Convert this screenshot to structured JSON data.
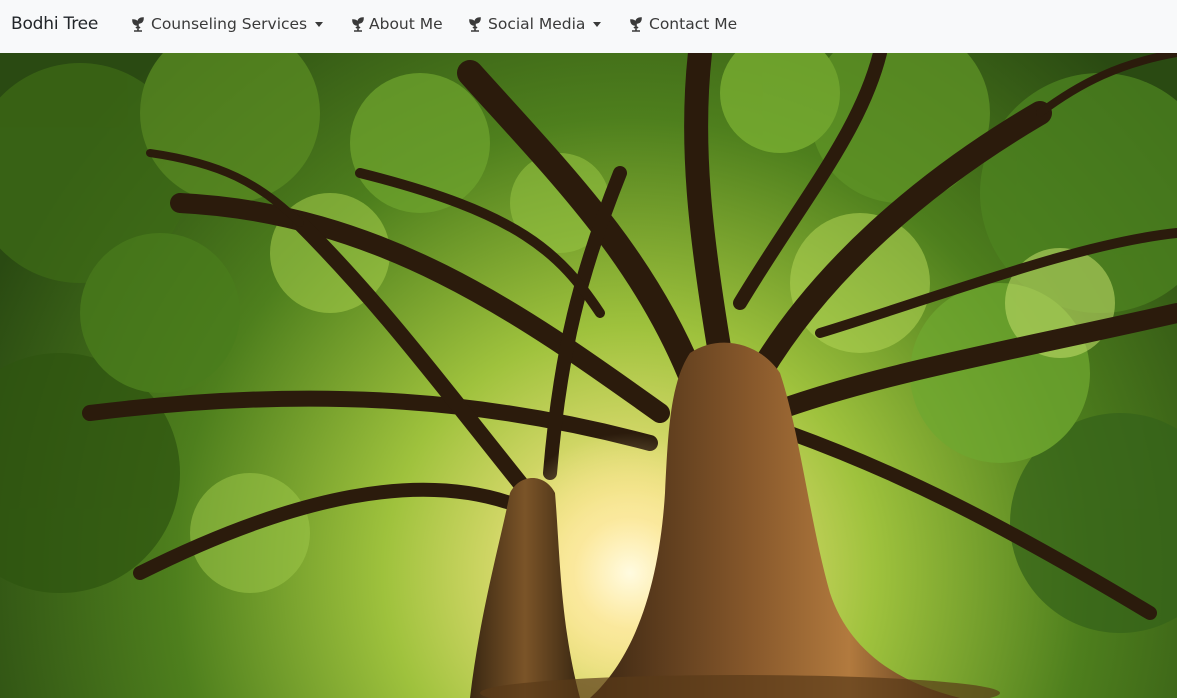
{
  "navbar": {
    "brand": "Bodhi Tree",
    "items": [
      {
        "label": "Counseling Services",
        "icon": "seedling-icon",
        "dropdown": true
      },
      {
        "label": "About Me",
        "icon": "seedling-icon",
        "dropdown": false
      },
      {
        "label": "Social Media",
        "icon": "seedling-icon",
        "dropdown": true
      },
      {
        "label": "Contact Me",
        "icon": "seedling-icon",
        "dropdown": false
      }
    ]
  },
  "hero": {
    "image": "tree-canopy-photo"
  },
  "colors": {
    "navbar_bg": "#f8f9fa",
    "nav_text": "#3a3a3a",
    "brand_text": "#212529"
  }
}
